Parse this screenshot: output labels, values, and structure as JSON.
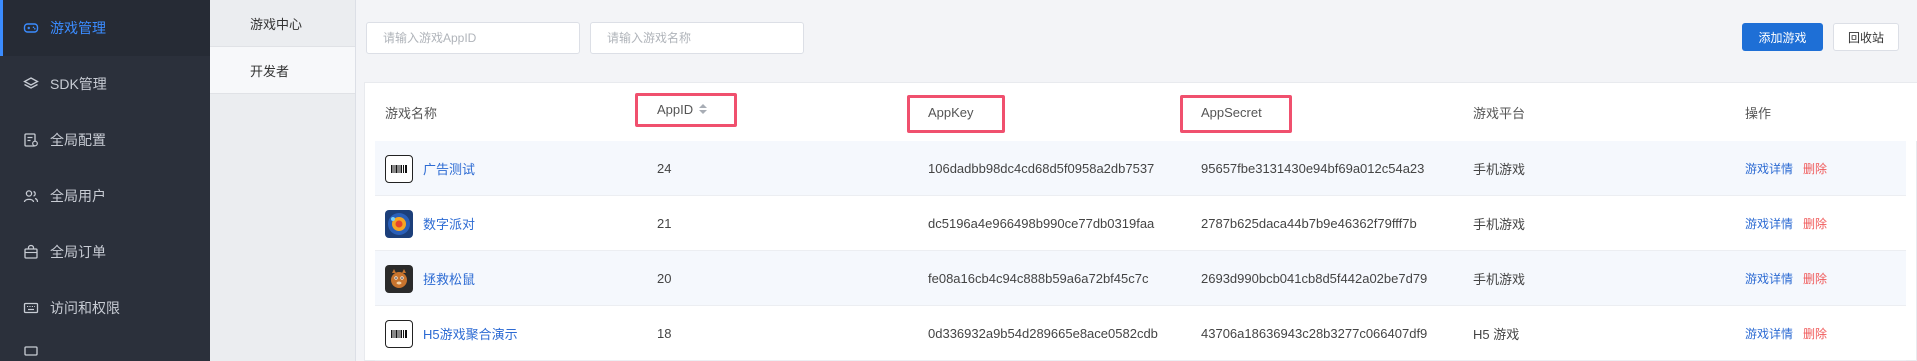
{
  "sidebar": {
    "items": [
      {
        "label": "游戏管理",
        "icon": "gamepad-icon",
        "active": true
      },
      {
        "label": "SDK管理",
        "icon": "layers-icon",
        "active": false
      },
      {
        "label": "全局配置",
        "icon": "config-icon",
        "active": false
      },
      {
        "label": "全局用户",
        "icon": "users-icon",
        "active": false
      },
      {
        "label": "全局订单",
        "icon": "bag-icon",
        "active": false
      },
      {
        "label": "访问和权限",
        "icon": "keyboard-icon",
        "active": false
      }
    ]
  },
  "subnav": {
    "items": [
      {
        "label": "游戏中心",
        "active": true
      },
      {
        "label": "开发者",
        "active": false
      }
    ]
  },
  "search": {
    "appid_placeholder": "请输入游戏AppID",
    "name_placeholder": "请输入游戏名称"
  },
  "toolbar": {
    "add_label": "添加游戏",
    "recycle_label": "回收站"
  },
  "table": {
    "headers": {
      "name": "游戏名称",
      "appid": "AppID",
      "appkey": "AppKey",
      "appsecret": "AppSecret",
      "platform": "游戏平台",
      "actions": "操作"
    },
    "rows": [
      {
        "name": "广告测试",
        "icon": "barcode-icon",
        "appid": "24",
        "appkey": "106dadbb98dc4cd68d5f0958a2db7537",
        "appsecret": "95657fbe3131430e94bf69a012c54a23",
        "platform": "手机游戏"
      },
      {
        "name": "数字派对",
        "icon": "party-game-icon",
        "appid": "21",
        "appkey": "dc5196a4e966498b990ce77db0319faa",
        "appsecret": "2787b625daca44b7b9e46362f79fff7b",
        "platform": "手机游戏"
      },
      {
        "name": "拯救松鼠",
        "icon": "squirrel-game-icon",
        "appid": "20",
        "appkey": "fe08a16cb4c94c888b59a6a72bf45c7c",
        "appsecret": "2693d990bcb041cb8d5f442a02be7d79",
        "platform": "手机游戏"
      },
      {
        "name": "H5游戏聚合演示",
        "icon": "barcode-icon",
        "appid": "18",
        "appkey": "0d336932a9b54d289665e8ace0582cdb",
        "appsecret": "43706a18636943c28b3277c066407df9",
        "platform": "H5 游戏"
      }
    ],
    "detail_label": "游戏详情",
    "delete_label": "删除"
  },
  "colors": {
    "sidebar_bg": "#2b303b",
    "accent": "#1e6fd6",
    "highlight_box": "#f0506e",
    "danger": "#f05a5a"
  }
}
